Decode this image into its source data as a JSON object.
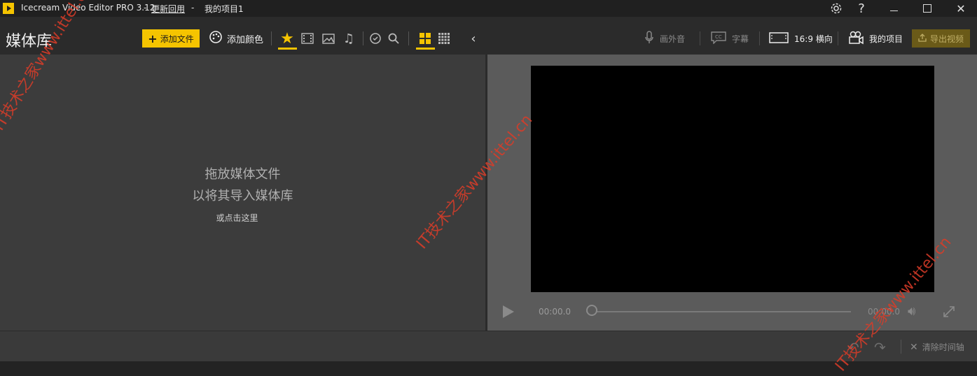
{
  "titlebar": {
    "app_title": "Icecream Video Editor PRO 3.12",
    "sep1": "-",
    "whats_new": "更新回用",
    "sep2": "-",
    "project_name": "我的项目1"
  },
  "left": {
    "title": "媒体库",
    "add_file": "添加文件",
    "add_color": "添加颜色",
    "drop_line1": "拖放媒体文件",
    "drop_line2": "以将其导入媒体库",
    "click_here": "或点击这里"
  },
  "right": {
    "voiceover": "画外音",
    "subtitles": "字幕",
    "aspect": "16:9 横向",
    "project": "我的项目",
    "export": "导出视频"
  },
  "player": {
    "time_current": "00:00.0",
    "time_end": "00:00.0"
  },
  "timeline": {
    "clear": "清除时间轴"
  },
  "watermark": {
    "text": "IT技术之家www.ittel.cn"
  },
  "colors": {
    "accent": "#f5c400",
    "bg_dark": "#2b2b2b",
    "panel": "#3c3c3c",
    "preview_bg": "#5b5b5b"
  }
}
